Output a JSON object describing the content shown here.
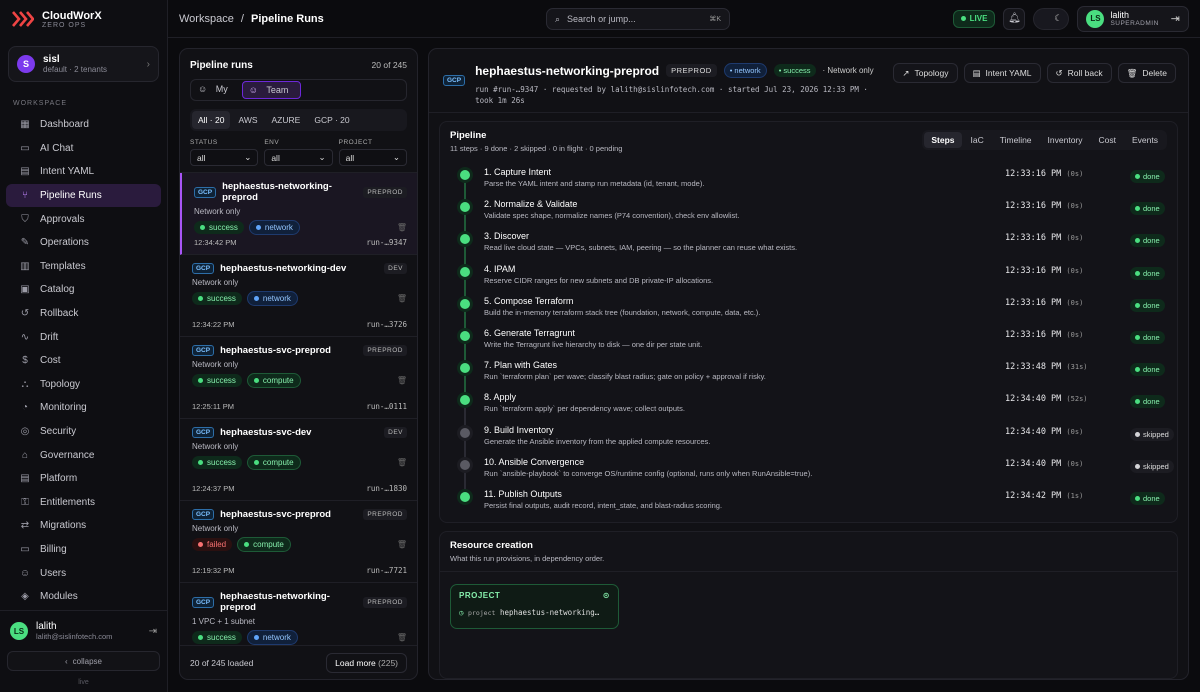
{
  "brand": {
    "name": "CloudWorX",
    "sub": "ZERO OPS"
  },
  "tenant": {
    "initial": "S",
    "name": "sisl",
    "sub": "default · 2 tenants"
  },
  "sidebar": {
    "section": "WORKSPACE",
    "items": [
      {
        "label": "Dashboard",
        "icon": "grid-icon",
        "glyph": "▦"
      },
      {
        "label": "AI Chat",
        "icon": "chat-icon",
        "glyph": "▭"
      },
      {
        "label": "Intent YAML",
        "icon": "file-icon",
        "glyph": "▤"
      },
      {
        "label": "Pipeline Runs",
        "icon": "branch-icon",
        "glyph": "⑂",
        "active": true
      },
      {
        "label": "Approvals",
        "icon": "shield-icon",
        "glyph": "⛉"
      },
      {
        "label": "Operations",
        "icon": "wrench-icon",
        "glyph": "✎"
      },
      {
        "label": "Templates",
        "icon": "template-icon",
        "glyph": "▥"
      },
      {
        "label": "Catalog",
        "icon": "catalog-icon",
        "glyph": "▣"
      },
      {
        "label": "Rollback",
        "icon": "rollback-icon",
        "glyph": "↺"
      },
      {
        "label": "Drift",
        "icon": "activity-icon",
        "glyph": "∿"
      },
      {
        "label": "Cost",
        "icon": "dollar-icon",
        "glyph": "$"
      },
      {
        "label": "Topology",
        "icon": "topology-icon",
        "glyph": "⛬"
      },
      {
        "label": "Monitoring",
        "icon": "gauge-icon",
        "glyph": "◔"
      },
      {
        "label": "Security",
        "icon": "security-icon",
        "glyph": "◎"
      },
      {
        "label": "Governance",
        "icon": "building-icon",
        "glyph": "⌂"
      },
      {
        "label": "Platform",
        "icon": "layers-icon",
        "glyph": "▤"
      },
      {
        "label": "Entitlements",
        "icon": "key-icon",
        "glyph": "⚿"
      },
      {
        "label": "Migrations",
        "icon": "arrows-icon",
        "glyph": "⇄"
      },
      {
        "label": "Billing",
        "icon": "receipt-icon",
        "glyph": "▭"
      },
      {
        "label": "Users",
        "icon": "users-icon",
        "glyph": "☺"
      },
      {
        "label": "Modules",
        "icon": "box-icon",
        "glyph": "◈"
      }
    ],
    "user": {
      "initials": "LS",
      "name": "lalith",
      "email": "lalith@sislinfotech.com"
    },
    "collapse_label": "collapse",
    "footer": "live"
  },
  "topbar": {
    "crumb_root": "Workspace",
    "crumb_sep": "/",
    "crumb_page": "Pipeline Runs",
    "search_placeholder": "Search or jump...",
    "search_shortcut": "⌘K",
    "live_label": "LIVE",
    "user": {
      "initials": "LS",
      "name": "lalith",
      "role": "SUPERADMIN"
    }
  },
  "runs": {
    "title": "Pipeline runs",
    "count": "20 of 245",
    "scope_tabs": [
      "My",
      "Team"
    ],
    "cloud_tabs": [
      "All · 20",
      "AWS",
      "AZURE",
      "GCP · 20"
    ],
    "filters": [
      {
        "label": "STATUS",
        "value": "all"
      },
      {
        "label": "ENV",
        "value": "all"
      },
      {
        "label": "PROJECT",
        "value": "all"
      }
    ],
    "items": [
      {
        "cloud": "GCP",
        "name": "hephaestus-networking-preprod",
        "env": "PREPROD",
        "desc": "Network only",
        "status": "success",
        "tag": "network",
        "time": "12:34:42 PM",
        "id": "run-…9347",
        "selected": true
      },
      {
        "cloud": "GCP",
        "name": "hephaestus-networking-dev",
        "env": "DEV",
        "desc": "Network only",
        "status": "success",
        "tag": "network",
        "time": "12:34:22 PM",
        "id": "run-…3726"
      },
      {
        "cloud": "GCP",
        "name": "hephaestus-svc-preprod",
        "env": "PREPROD",
        "desc": "Network only",
        "status": "success",
        "tag": "compute",
        "time": "12:25:11 PM",
        "id": "run-…0111"
      },
      {
        "cloud": "GCP",
        "name": "hephaestus-svc-dev",
        "env": "DEV",
        "desc": "Network only",
        "status": "success",
        "tag": "compute",
        "time": "12:24:37 PM",
        "id": "run-…1830"
      },
      {
        "cloud": "GCP",
        "name": "hephaestus-svc-preprod",
        "env": "PREPROD",
        "desc": "Network only",
        "status": "failed",
        "tag": "compute",
        "time": "12:19:32 PM",
        "id": "run-…7721"
      },
      {
        "cloud": "GCP",
        "name": "hephaestus-networking-preprod",
        "env": "PREPROD",
        "desc": "1 VPC + 1 subnet",
        "status": "success",
        "tag": "network",
        "time": "",
        "id": ""
      }
    ],
    "loaded": "20 of 245 loaded",
    "load_more": "Load more",
    "load_more_count": "(225)"
  },
  "detail": {
    "cloud": "GCP",
    "name": "hephaestus-networking-preprod",
    "env": "PREPROD",
    "tag": "network",
    "status": "success",
    "scope": "· Network only",
    "meta_line1": "run #run-…9347 · requested by lalith@sislinfotech.com · started Jul 23, 2026 12:33 PM ·",
    "meta_line2": "took 1m 26s",
    "actions": [
      {
        "label": "Topology",
        "icon": "external-link-icon",
        "glyph": "↗"
      },
      {
        "label": "Intent YAML",
        "icon": "file-icon",
        "glyph": "▤"
      },
      {
        "label": "Roll back",
        "icon": "rollback-icon",
        "glyph": "↺"
      },
      {
        "label": "Delete",
        "icon": "trash-icon",
        "glyph": "🗑"
      }
    ],
    "pipeline": {
      "title": "Pipeline",
      "summary": "11 steps · 9 done · 2 skipped · 0 in flight · 0 pending",
      "tabs": [
        "Steps",
        "IaC",
        "Timeline",
        "Inventory",
        "Cost",
        "Events"
      ],
      "steps": [
        {
          "name": "1. Capture Intent",
          "desc": "Parse the YAML intent and stamp run metadata (id, tenant, mode).",
          "time": "12:33:16 PM",
          "dur": "(0s)",
          "status": "done"
        },
        {
          "name": "2. Normalize & Validate",
          "desc": "Validate spec shape, normalize names (P74 convention), check env allowlist.",
          "time": "12:33:16 PM",
          "dur": "(0s)",
          "status": "done"
        },
        {
          "name": "3. Discover",
          "desc": "Read live cloud state — VPCs, subnets, IAM, peering — so the planner can reuse what exists.",
          "time": "12:33:16 PM",
          "dur": "(0s)",
          "status": "done"
        },
        {
          "name": "4. IPAM",
          "desc": "Reserve CIDR ranges for new subnets and DB private-IP allocations.",
          "time": "12:33:16 PM",
          "dur": "(0s)",
          "status": "done"
        },
        {
          "name": "5. Compose Terraform",
          "desc": "Build the in-memory terraform stack tree (foundation, network, compute, data, etc.).",
          "time": "12:33:16 PM",
          "dur": "(0s)",
          "status": "done"
        },
        {
          "name": "6. Generate Terragrunt",
          "desc": "Write the Terragrunt live hierarchy to disk — one dir per state unit.",
          "time": "12:33:16 PM",
          "dur": "(0s)",
          "status": "done"
        },
        {
          "name": "7. Plan with Gates",
          "desc": "Run `terraform plan` per wave; classify blast radius; gate on policy + approval if risky.",
          "time": "12:33:48 PM",
          "dur": "(31s)",
          "status": "done"
        },
        {
          "name": "8. Apply",
          "desc": "Run `terraform apply` per dependency wave; collect outputs.",
          "time": "12:34:40 PM",
          "dur": "(52s)",
          "status": "done"
        },
        {
          "name": "9. Build Inventory",
          "desc": "Generate the Ansible inventory from the applied compute resources.",
          "time": "12:34:40 PM",
          "dur": "(0s)",
          "status": "skipped"
        },
        {
          "name": "10. Ansible Convergence",
          "desc": "Run `ansible-playbook` to converge OS/runtime config (optional, runs only when RunAnsible=true).",
          "time": "12:34:40 PM",
          "dur": "(0s)",
          "status": "skipped"
        },
        {
          "name": "11. Publish Outputs",
          "desc": "Persist final outputs, audit record, intent_state, and blast-radius scoring.",
          "time": "12:34:42 PM",
          "dur": "(1s)",
          "status": "done"
        }
      ]
    },
    "resources": {
      "title": "Resource creation",
      "subtitle": "What this run provisions, in dependency order.",
      "card_title": "PROJECT",
      "card_type": "project",
      "card_value": "hephaestus-networking…"
    }
  },
  "colors": {
    "accent": "#a855f7",
    "success": "#4ade80",
    "failed": "#f87171",
    "network": "#93c5fd"
  }
}
